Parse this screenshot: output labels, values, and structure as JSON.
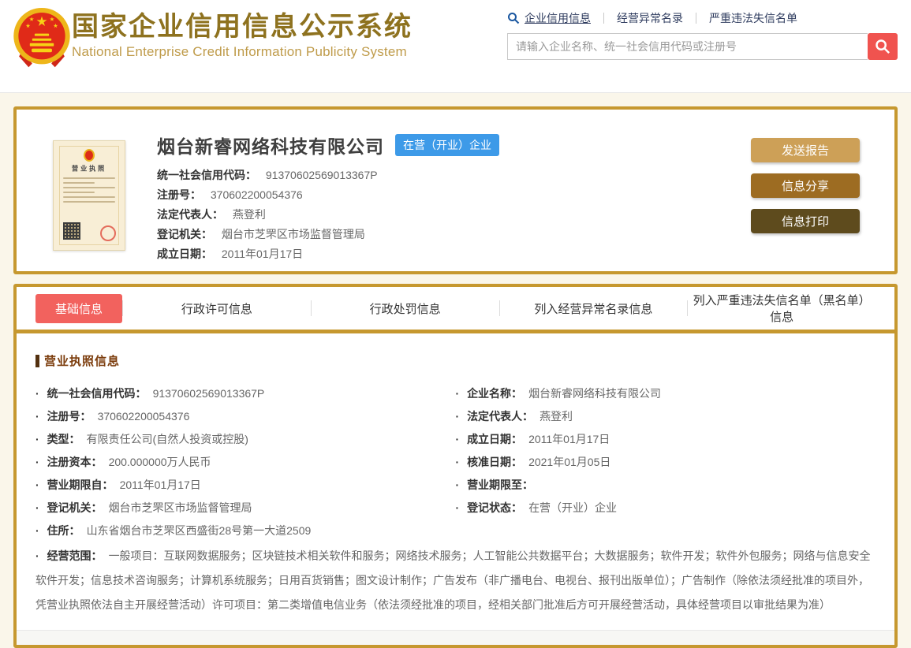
{
  "header": {
    "site_title": "国家企业信用信息公示系统",
    "site_subtitle": "National Enterprise Credit Information Publicity System",
    "search_tabs": [
      {
        "label": "企业信用信息",
        "active": true
      },
      {
        "label": "经营异常名录",
        "active": false
      },
      {
        "label": "严重违法失信名单",
        "active": false
      }
    ],
    "search_placeholder": "请输入企业名称、统一社会信用代码或注册号"
  },
  "summary_card": {
    "company_name": "烟台新睿网络科技有限公司",
    "status_badge": "在营（开业）企业",
    "license_title": "营业执照",
    "fields": [
      {
        "label": "统一社会信用代码：",
        "value": "91370602569013367P"
      },
      {
        "label": "注册号：",
        "value": "370602200054376"
      },
      {
        "label": "法定代表人：",
        "value": "燕登利"
      },
      {
        "label": "登记机关：",
        "value": "烟台市芝罘区市场监督管理局"
      },
      {
        "label": "成立日期：",
        "value": "2011年01月17日"
      }
    ],
    "buttons": [
      {
        "label": "发送报告",
        "color": "#cda057"
      },
      {
        "label": "信息分享",
        "color": "#9d6c22"
      },
      {
        "label": "信息打印",
        "color": "#5e4b1d"
      }
    ]
  },
  "tabs": [
    {
      "label": "基础信息",
      "active": true
    },
    {
      "label": "行政许可信息",
      "active": false
    },
    {
      "label": "行政处罚信息",
      "active": false
    },
    {
      "label": "列入经营异常名录信息",
      "active": false
    },
    {
      "label": "列入严重违法失信名单（黑名单）信息",
      "active": false
    }
  ],
  "detail": {
    "section_title": "营业执照信息",
    "left_fields": [
      {
        "label": "统一社会信用代码：",
        "value": "91370602569013367P"
      },
      {
        "label": "注册号：",
        "value": "370602200054376"
      },
      {
        "label": "类型：",
        "value": "有限责任公司(自然人投资或控股)"
      },
      {
        "label": "注册资本：",
        "value": "200.000000万人民币"
      },
      {
        "label": "营业期限自：",
        "value": "2011年01月17日"
      },
      {
        "label": "登记机关：",
        "value": "烟台市芝罘区市场监督管理局"
      }
    ],
    "right_fields": [
      {
        "label": "企业名称：",
        "value": "烟台新睿网络科技有限公司"
      },
      {
        "label": "法定代表人：",
        "value": "燕登利"
      },
      {
        "label": "成立日期：",
        "value": "2011年01月17日"
      },
      {
        "label": "核准日期：",
        "value": "2021年01月05日"
      },
      {
        "label": "营业期限至：",
        "value": ""
      },
      {
        "label": "登记状态：",
        "value": "在营（开业）企业"
      }
    ],
    "full_fields": [
      {
        "label": "住所：",
        "value": "山东省烟台市芝罘区西盛街28号第一大道2509"
      },
      {
        "label": "经营范围：",
        "value": "一般项目：互联网数据服务；区块链技术相关软件和服务；网络技术服务；人工智能公共数据平台；大数据服务；软件开发；软件外包服务；网络与信息安全软件开发；信息技术咨询服务；计算机系统服务；日用百货销售；图文设计制作；广告发布（非广播电台、电视台、报刊出版单位）；广告制作（除依法须经批准的项目外，凭营业执照依法自主开展经营活动）许可项目：第二类增值电信业务（依法须经批准的项目，经相关部门批准后方可开展经营活动，具体经营项目以审批结果为准）"
      }
    ]
  },
  "colors": {
    "gold_border": "#c6982f",
    "title_gold": "#8e721f",
    "active_red": "#f2625e",
    "badge_blue": "#3d9ae8"
  }
}
